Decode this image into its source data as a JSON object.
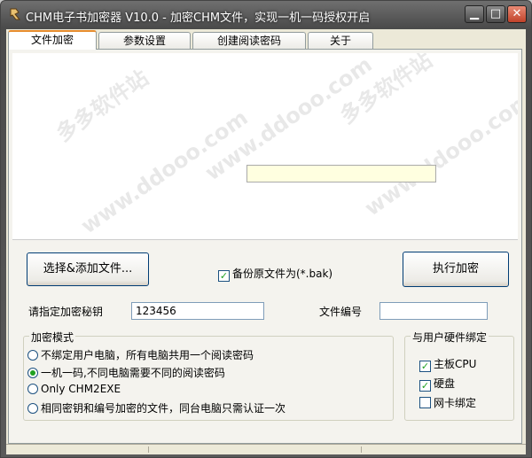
{
  "window": {
    "title": "CHM电子书加密器 V10.0 - 加密CHM文件，实现一机一码授权开启",
    "controls": {
      "minimize": "▁",
      "maximize": "□",
      "close": "✕"
    }
  },
  "tabs": [
    {
      "label": "文件加密",
      "active": true
    },
    {
      "label": "参数设置",
      "active": false
    },
    {
      "label": "创建阅读密码",
      "active": false
    },
    {
      "label": "关于",
      "active": false
    }
  ],
  "main": {
    "select_button": "选择&添加文件...",
    "backup_label": "备份原文件为(*.bak)",
    "backup_checked": true,
    "encrypt_button": "执行加密",
    "key_label": "请指定加密秘钥",
    "key_value": "123456",
    "file_number_label": "文件编号",
    "file_number_value": ""
  },
  "encryption_mode": {
    "title": "加密模式",
    "options": [
      {
        "label": "不绑定用户电脑，所有电脑共用一个阅读密码",
        "selected": false
      },
      {
        "label": "一机一码,不同电脑需要不同的阅读密码",
        "selected": true
      },
      {
        "label": "Only CHM2EXE",
        "selected": false
      },
      {
        "label": "相同密钥和编号加密的文件，同台电脑只需认证一次",
        "selected": false
      }
    ]
  },
  "hardware_binding": {
    "title": "与用户硬件绑定",
    "options": [
      {
        "label": "主板CPU",
        "checked": true
      },
      {
        "label": "硬盘",
        "checked": true
      },
      {
        "label": "网卡绑定",
        "checked": false
      }
    ]
  },
  "watermark": {
    "cn": "多多软件站",
    "url": "www.ddooo.com"
  },
  "colors": {
    "accent": "#21a121",
    "tab_highlight": "#e68b2c",
    "close": "#c1422a"
  }
}
